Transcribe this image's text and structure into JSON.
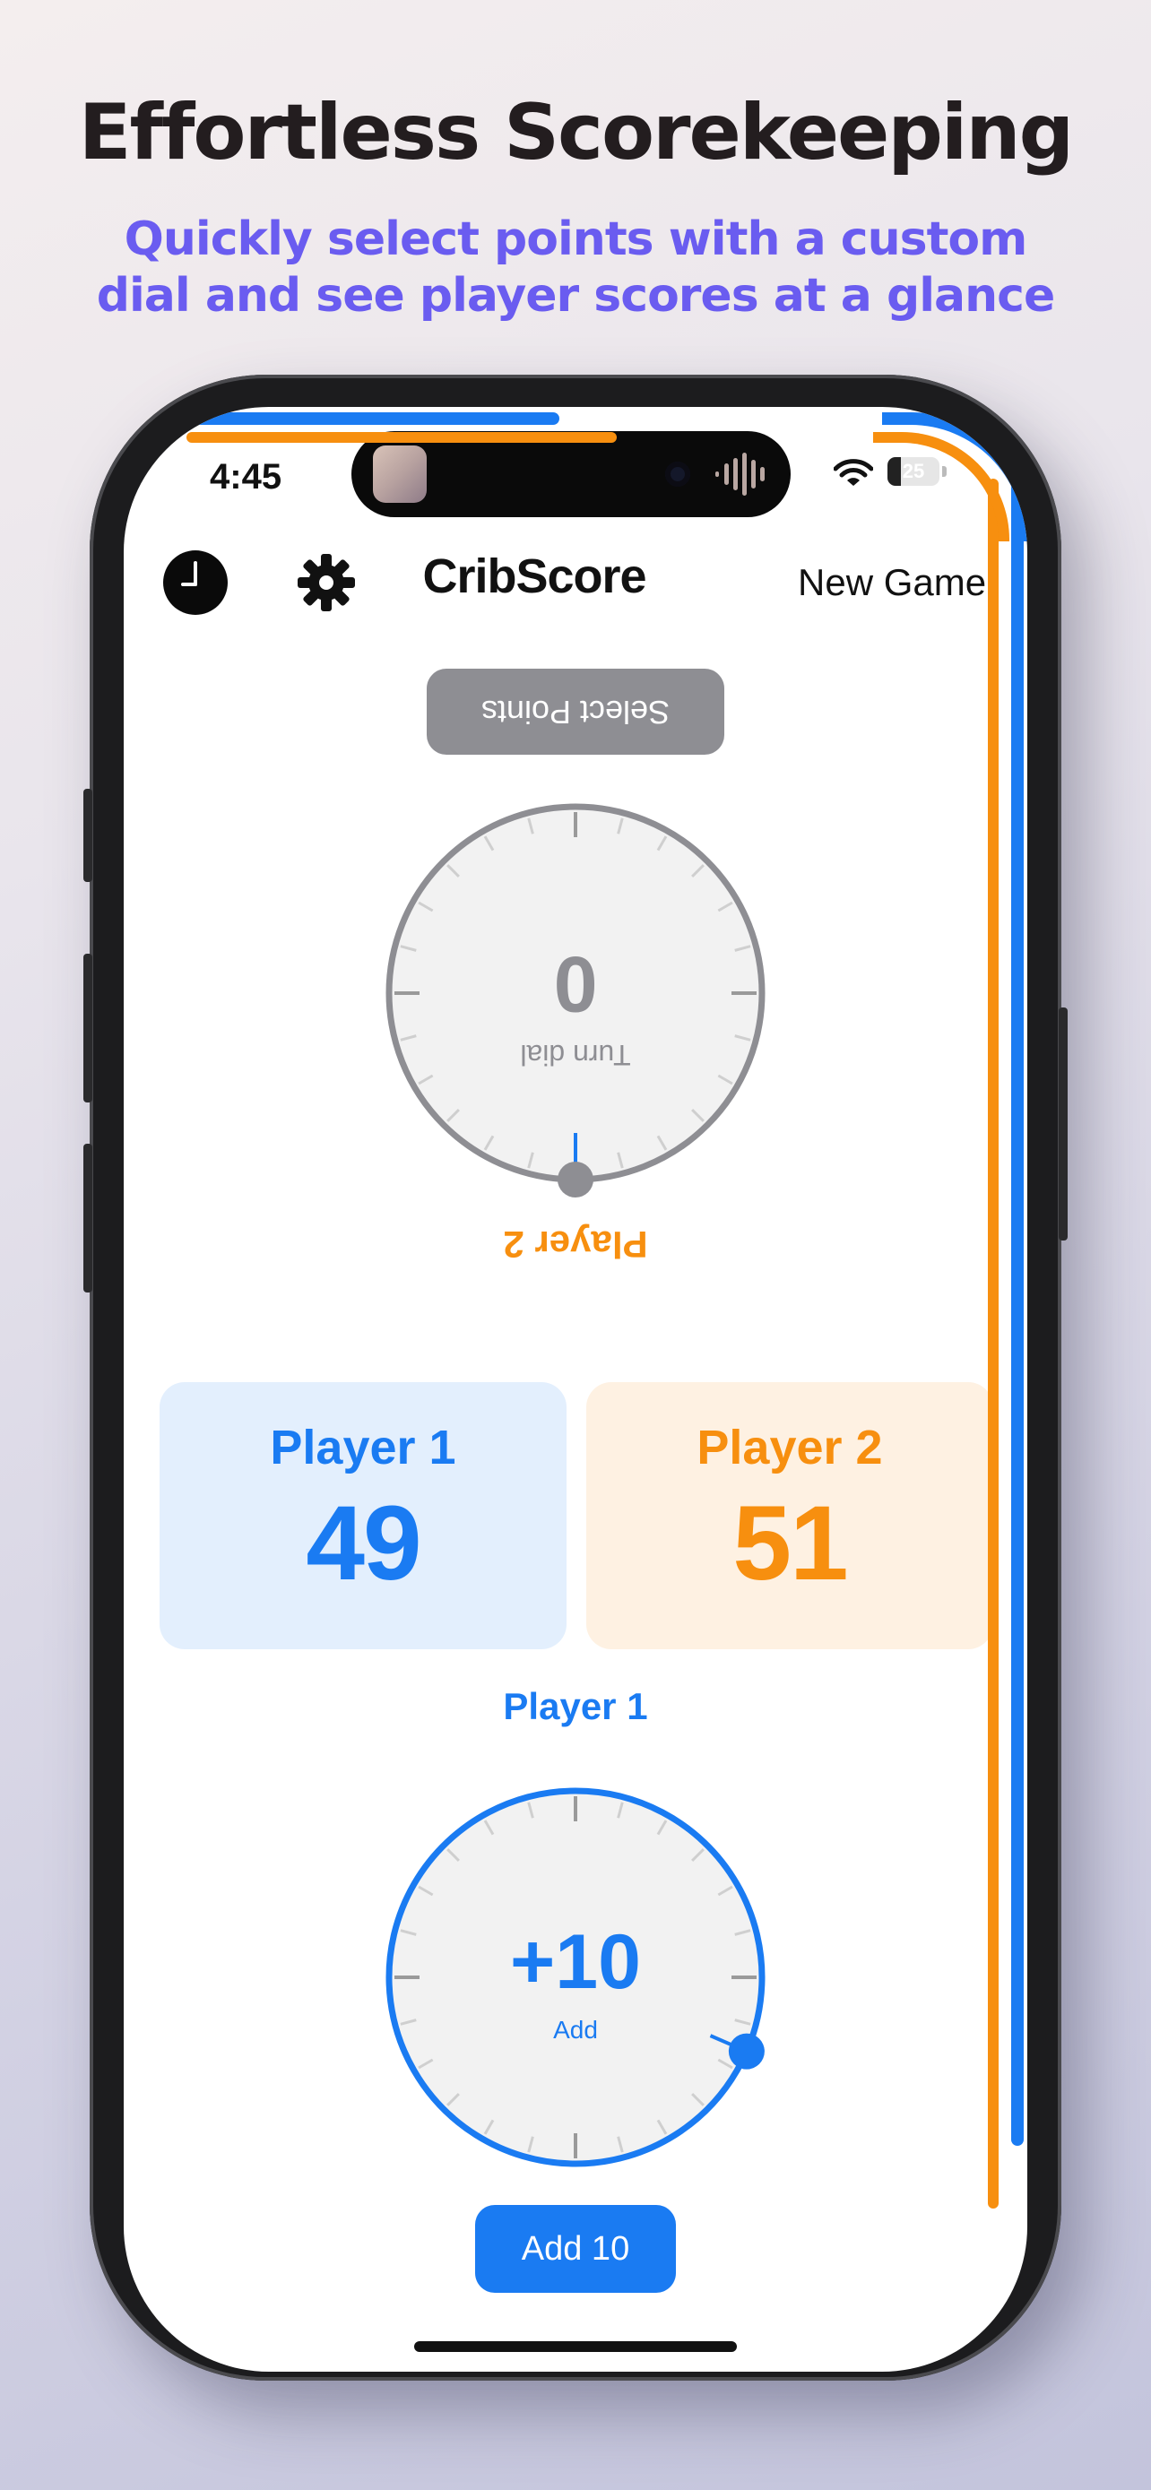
{
  "marketing": {
    "headline": "Effortless Scorekeeping",
    "subline_line1": "Quickly select points with a custom",
    "subline_line2": "dial and see player scores at a glance",
    "subline_color": "#6a5cf0"
  },
  "status_bar": {
    "time": "4:45",
    "battery": "25",
    "battery_level": 0.25
  },
  "toolbar": {
    "history_icon": "clock-icon",
    "settings_icon": "gear-icon",
    "title": "CribScore",
    "new_game_label": "New Game"
  },
  "opponent_panel": {
    "select_points_label": "Select Points",
    "dial_hint": "Turn dial",
    "dial_value": "0",
    "player_label": "Player 2",
    "orientation": "upside-down"
  },
  "scores": [
    {
      "name": "Player 1",
      "score": "49",
      "color": "#1a7bf2",
      "background": "#e3effd"
    },
    {
      "name": "Player 2",
      "score": "51",
      "color": "#f78f0f",
      "background": "#fef1e2"
    }
  ],
  "active_panel": {
    "player_label": "Player 1",
    "dial_value": "+10",
    "dial_action": "Add",
    "add_button_label": "Add 10",
    "dial_fraction": 0.37
  },
  "colors": {
    "player1": "#1a7bf2",
    "player2": "#f78f0f",
    "neutral_dial": "#8e8e93",
    "dial_face": "#f2f2f2"
  }
}
